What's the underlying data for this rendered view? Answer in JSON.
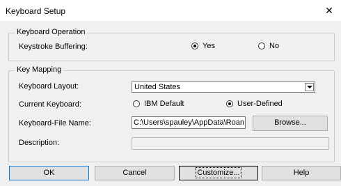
{
  "window": {
    "title": "Keyboard Setup",
    "close_glyph": "✕"
  },
  "keyboard_operation": {
    "legend": "Keyboard Operation",
    "buffering_label": "Keystroke Buffering:",
    "yes_label": "Yes",
    "no_label": "No",
    "selected": "Yes"
  },
  "key_mapping": {
    "legend": "Key Mapping",
    "layout_label": "Keyboard Layout:",
    "layout_value": "United States",
    "current_label": "Current Keyboard:",
    "ibm_label": "IBM Default",
    "user_label": "User-Defined",
    "selected": "User-Defined",
    "file_label": "Keyboard-File Name:",
    "file_value": "C:\\Users\\spauley\\AppData\\Roan",
    "browse_label": "Browse...",
    "description_label": "Description:",
    "description_value": ""
  },
  "buttons": {
    "ok": "OK",
    "cancel": "Cancel",
    "customize": "Customize...",
    "help": "Help"
  }
}
